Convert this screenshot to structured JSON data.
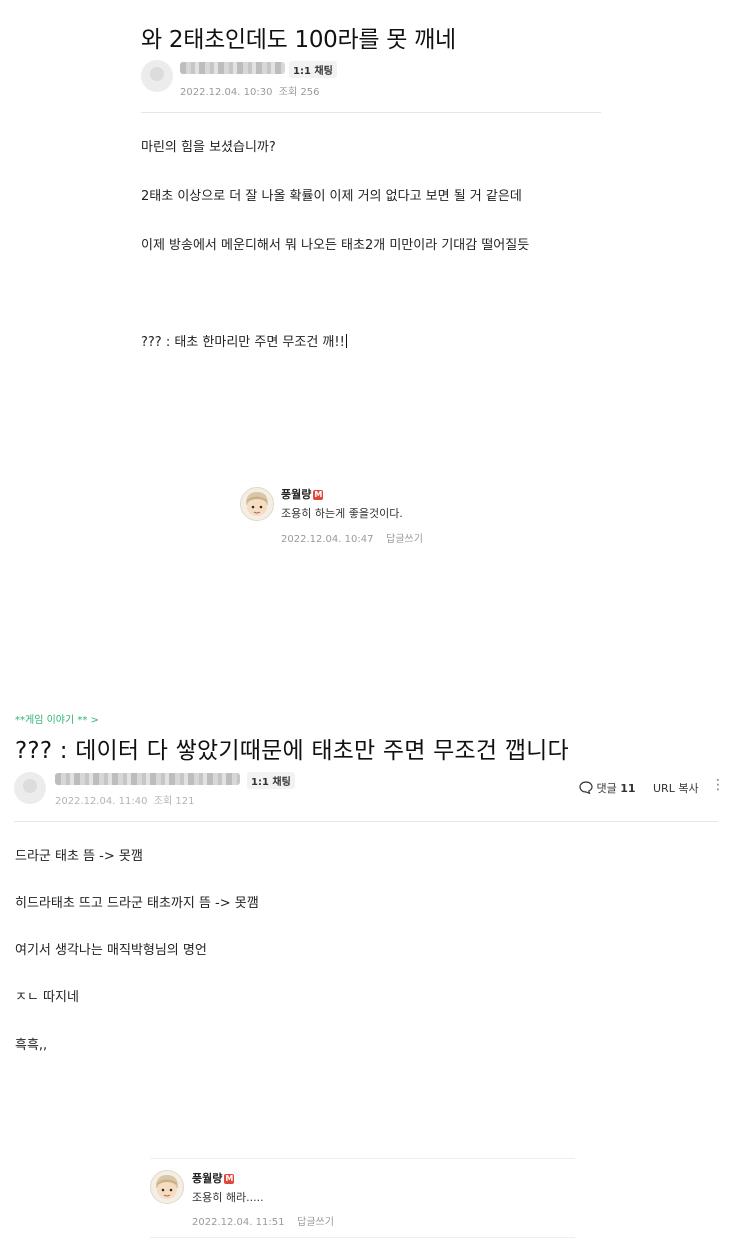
{
  "post1": {
    "title": "와 2태초인데도 100라를 못 깨네",
    "author_badge": "1:1 채팅",
    "date": "2022.12.04. 10:30",
    "views": "조회 256",
    "lines": [
      "마린의 힘을 보셨습니까?",
      "2태초 이상으로 더 잘 나올 확률이 이제 거의 없다고 보면 될 거 같은데",
      "이제 방송에서 메운디해서 뭐 나오든 태초2개 미만이라 기대감 떨어질듯",
      "??? : 태초 한마리만 주면 무조건 깨!!"
    ],
    "comment": {
      "nickname": "풍월량",
      "badge": "M",
      "text": "조용히 하는게 좋을것이다.",
      "date": "2022.12.04. 10:47",
      "reply_label": "답글쓰기"
    }
  },
  "post2": {
    "cafe_link": "**게임 이야기 ** >",
    "title": "??? : 데이터 다 쌓았기때문에 태초만 주면 무조건 깹니다",
    "author_badge": "1:1 채팅",
    "date": "2022.12.04. 11:40",
    "views": "조회 121",
    "comments_label": "댓글",
    "comments_count": "11",
    "url_copy_label": "URL 복사",
    "lines": [
      "드라군 태초 뜸 -> 못깸",
      "히드라태초 뜨고 드라군 태초까지 뜸 -> 못깸",
      "여기서 생각나는 매직박형님의 명언",
      "ㅈㄴ 따지네",
      "흑흑,,"
    ],
    "comment": {
      "nickname": "풍월량",
      "badge": "M",
      "text": "조용히 해라.....",
      "date": "2022.12.04. 11:51",
      "reply_label": "답글쓰기"
    }
  }
}
